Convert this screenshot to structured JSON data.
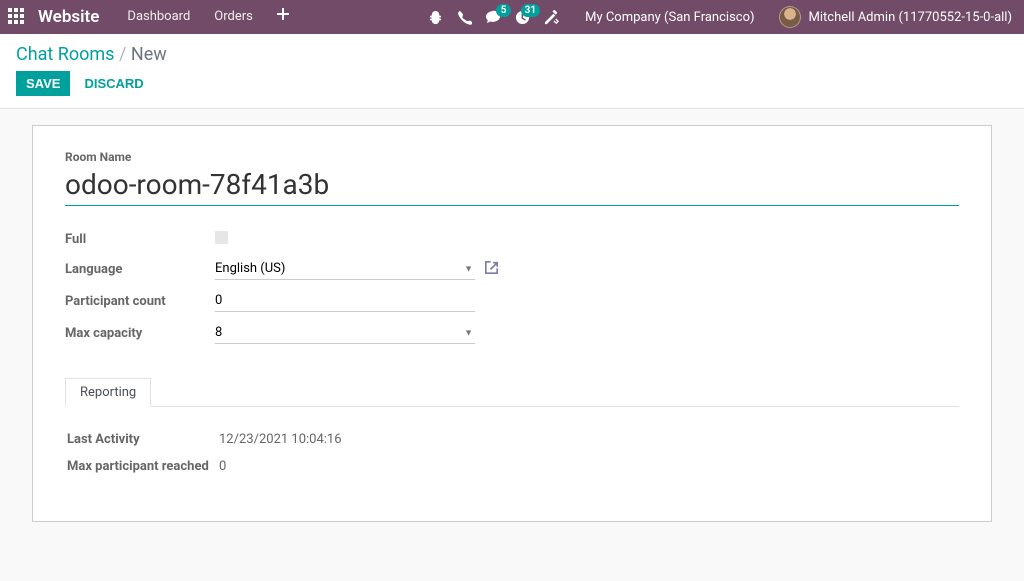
{
  "navbar": {
    "brand": "Website",
    "links": {
      "dashboard": "Dashboard",
      "orders": "Orders"
    },
    "messaging_badge": "5",
    "activities_badge": "31",
    "company": "My Company (San Francisco)",
    "user": "Mitchell Admin (11770552-15-0-all)"
  },
  "breadcrumb": {
    "parent": "Chat Rooms",
    "current": "New"
  },
  "buttons": {
    "save": "Save",
    "discard": "Discard"
  },
  "form": {
    "room_name_label": "Room Name",
    "room_name_value": "odoo-room-78f41a3b",
    "full_label": "Full",
    "language_label": "Language",
    "language_value": "English (US)",
    "participant_count_label": "Participant count",
    "participant_count_value": "0",
    "max_capacity_label": "Max capacity",
    "max_capacity_value": "8"
  },
  "tabs": {
    "reporting": "Reporting"
  },
  "reporting": {
    "last_activity_label": "Last Activity",
    "last_activity_value": "12/23/2021 10:04:16",
    "max_participant_reached_label": "Max participant reached",
    "max_participant_reached_value": "0"
  }
}
